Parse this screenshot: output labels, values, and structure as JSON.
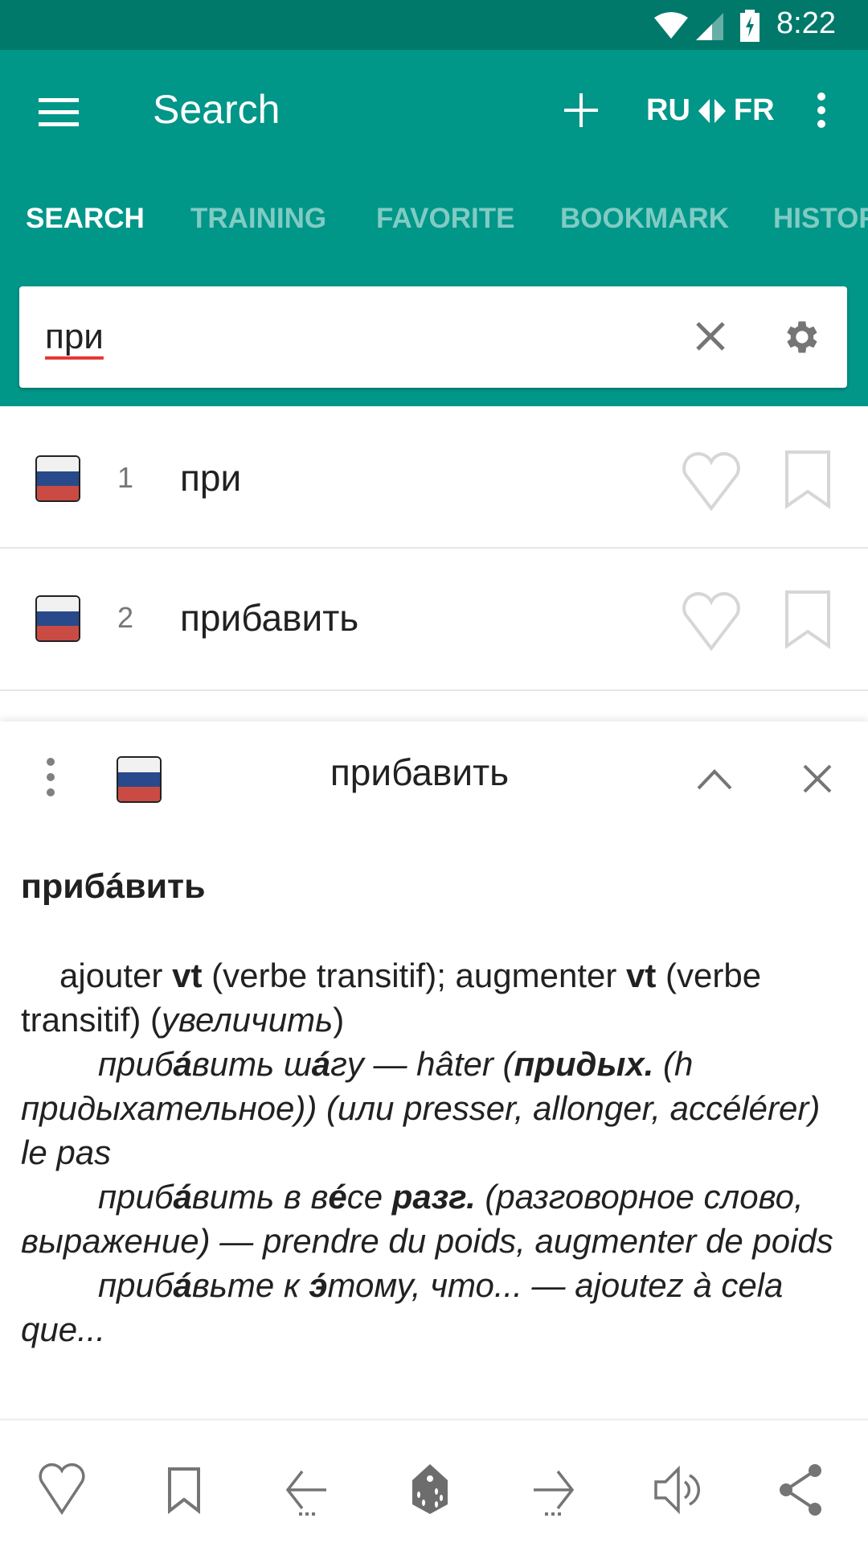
{
  "status_bar": {
    "time": "8:22",
    "icons": [
      "wifi-icon",
      "signal-icon",
      "battery-charging-icon"
    ]
  },
  "app_bar": {
    "title": "Search",
    "add_label": "+",
    "source_lang": "RU",
    "target_lang": "FR",
    "swap_icon": "swap-arrows-icon"
  },
  "tabs": [
    {
      "label": "SEARCH",
      "active": true
    },
    {
      "label": "TRAINING",
      "active": false
    },
    {
      "label": "FAVORITE",
      "active": false
    },
    {
      "label": "BOOKMARK",
      "active": false
    },
    {
      "label": "HISTORY",
      "active": false
    }
  ],
  "search": {
    "value": "при"
  },
  "results": [
    {
      "index": "1",
      "word": "при",
      "lang": "ru"
    },
    {
      "index": "2",
      "word": "прибавить",
      "lang": "ru"
    }
  ],
  "sheet": {
    "title": "прибавить",
    "headword": "прибáвить",
    "lines": [
      {
        "style": "ind1",
        "html": "ajouter <b>vt</b> (verbe transitif); augmenter <b>vt</b> (verbe transitif) (<i>увеличить</i>)"
      },
      {
        "style": "ind2",
        "html": "приб<b>á</b>вить ш<b>á</b>гу — hâter (<b>придых.</b> (h придыхательное)) (или presser, allonger, accélérer) le pas"
      },
      {
        "style": "ind2",
        "html": "приб<b>á</b>вить в в<b>é</b>се <b>разг.</b> (разговорное слово, выражение) — prendre du poids, augmenter de poids"
      },
      {
        "style": "ind2",
        "html": "приб<b>á</b>вьте к <b>э́</b>тому, что... — ajoutez à cela que..."
      }
    ]
  },
  "bottom_bar": [
    "heart-icon",
    "bookmark-icon",
    "previous-arrow-icon",
    "random-dice-icon",
    "next-arrow-icon",
    "speaker-icon",
    "share-icon"
  ],
  "colors": {
    "primary": "#009688",
    "primary_dark": "#00796b",
    "icon_gray": "#757575"
  }
}
